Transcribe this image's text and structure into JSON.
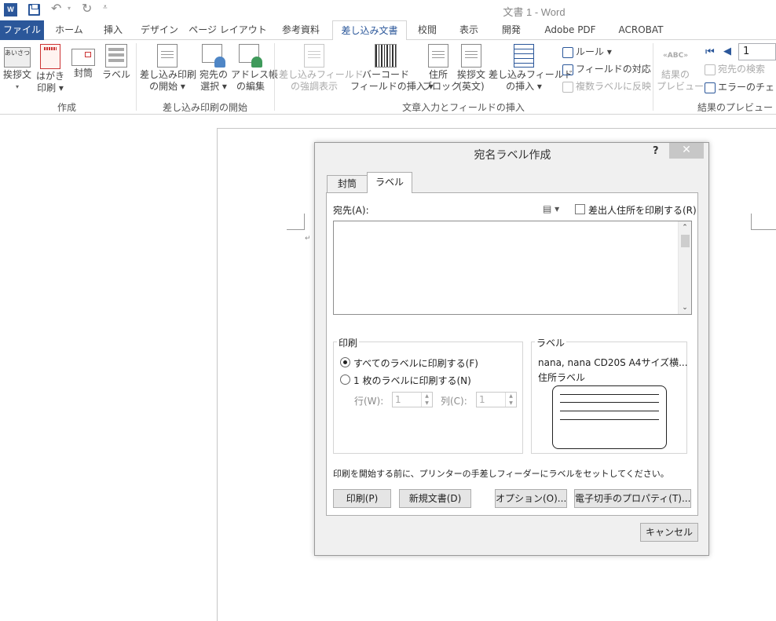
{
  "titlebar": {
    "app_logo": "W",
    "doc_title": "文書 1 - Word",
    "icons": [
      "word-logo-icon",
      "save-icon",
      "undo-icon",
      "redo-icon",
      "customize-qat-icon"
    ]
  },
  "tabs": [
    {
      "label": "ファイル"
    },
    {
      "label": "ホーム"
    },
    {
      "label": "挿入"
    },
    {
      "label": "デザイン"
    },
    {
      "label": "ページ レイアウト"
    },
    {
      "label": "参考資料"
    },
    {
      "label": "差し込み文書"
    },
    {
      "label": "校閲"
    },
    {
      "label": "表示"
    },
    {
      "label": "開発"
    },
    {
      "label": "Adobe PDF"
    },
    {
      "label": "ACROBAT"
    }
  ],
  "ribbon": {
    "create": {
      "group_label": "作成",
      "greeting_icon_text": "あいさつ",
      "greeting": {
        "l1": "挨拶文",
        "l2": "▾"
      },
      "postcard": {
        "l1": "はがき",
        "l2": "印刷 ▾"
      },
      "envelope": {
        "l1": "封筒"
      },
      "labels": {
        "l1": "ラベル"
      }
    },
    "start": {
      "group_label": "差し込み印刷の開始",
      "start_merge": {
        "l1": "差し込み印刷",
        "l2": "の開始 ▾"
      },
      "select_recipients": {
        "l1": "宛先の",
        "l2": "選択 ▾"
      },
      "edit_list": {
        "l1": "アドレス帳",
        "l2": "の編集"
      }
    },
    "insert": {
      "group_label": "文章入力とフィールドの挿入",
      "highlight_fields": {
        "l1": "差し込みフィールド",
        "l2": "の強調表示"
      },
      "barcode": {
        "l1": "バーコード",
        "l2": "フィールドの挿入 ▾"
      },
      "address_block": {
        "l1": "住所",
        "l2": "ブロック"
      },
      "greeting_line": {
        "l1": "挨拶文",
        "l2": "(英文)"
      },
      "insert_field": {
        "l1": "差し込みフィールド",
        "l2": "の挿入 ▾"
      },
      "rules": "ルール ▾",
      "match_fields": "フィールドの対応",
      "update_labels": "複数ラベルに反映"
    },
    "preview": {
      "group_label": "結果のプレビュー",
      "preview_results": {
        "l1": "結果の",
        "l2": "プレビュー"
      },
      "abc_icon_text": "«ABC»",
      "find_recipient": "宛先の検索",
      "check_errors": "エラーのチェック",
      "record_value": "1"
    }
  },
  "document": {
    "paragraph_mark": "↵"
  },
  "dialog": {
    "title": "宛名ラベル作成",
    "help": "?",
    "close": "✕",
    "tabs": {
      "envelope": "封筒",
      "labels": "ラベル"
    },
    "address_label": "宛先(A):",
    "address_value": "",
    "address_book_glyph": "▤ ▾",
    "return_address_checkbox": {
      "label": "差出人住所を印刷する(R)",
      "checked": false
    },
    "print_group": {
      "legend": "印刷",
      "full_page": {
        "label": "すべてのラベルに印刷する(F)",
        "selected": true
      },
      "single": {
        "label": "1 枚のラベルに印刷する(N)",
        "selected": false
      },
      "row_label": "行(W):",
      "row_value": "1",
      "col_label": "列(C):",
      "col_value": "1"
    },
    "label_group": {
      "legend": "ラベル",
      "vendor_product": "nana, nana CD20S A4サイズ横...",
      "label_type": "住所ラベル"
    },
    "note": "印刷を開始する前に、プリンターの手差しフィーダーにラベルをセットしてください。",
    "buttons": {
      "print": "印刷(P)",
      "new_document": "新規文書(D)",
      "options": "オプション(O)...",
      "epostage": "電子切手のプロパティ(T)...",
      "cancel": "キャンセル"
    }
  }
}
